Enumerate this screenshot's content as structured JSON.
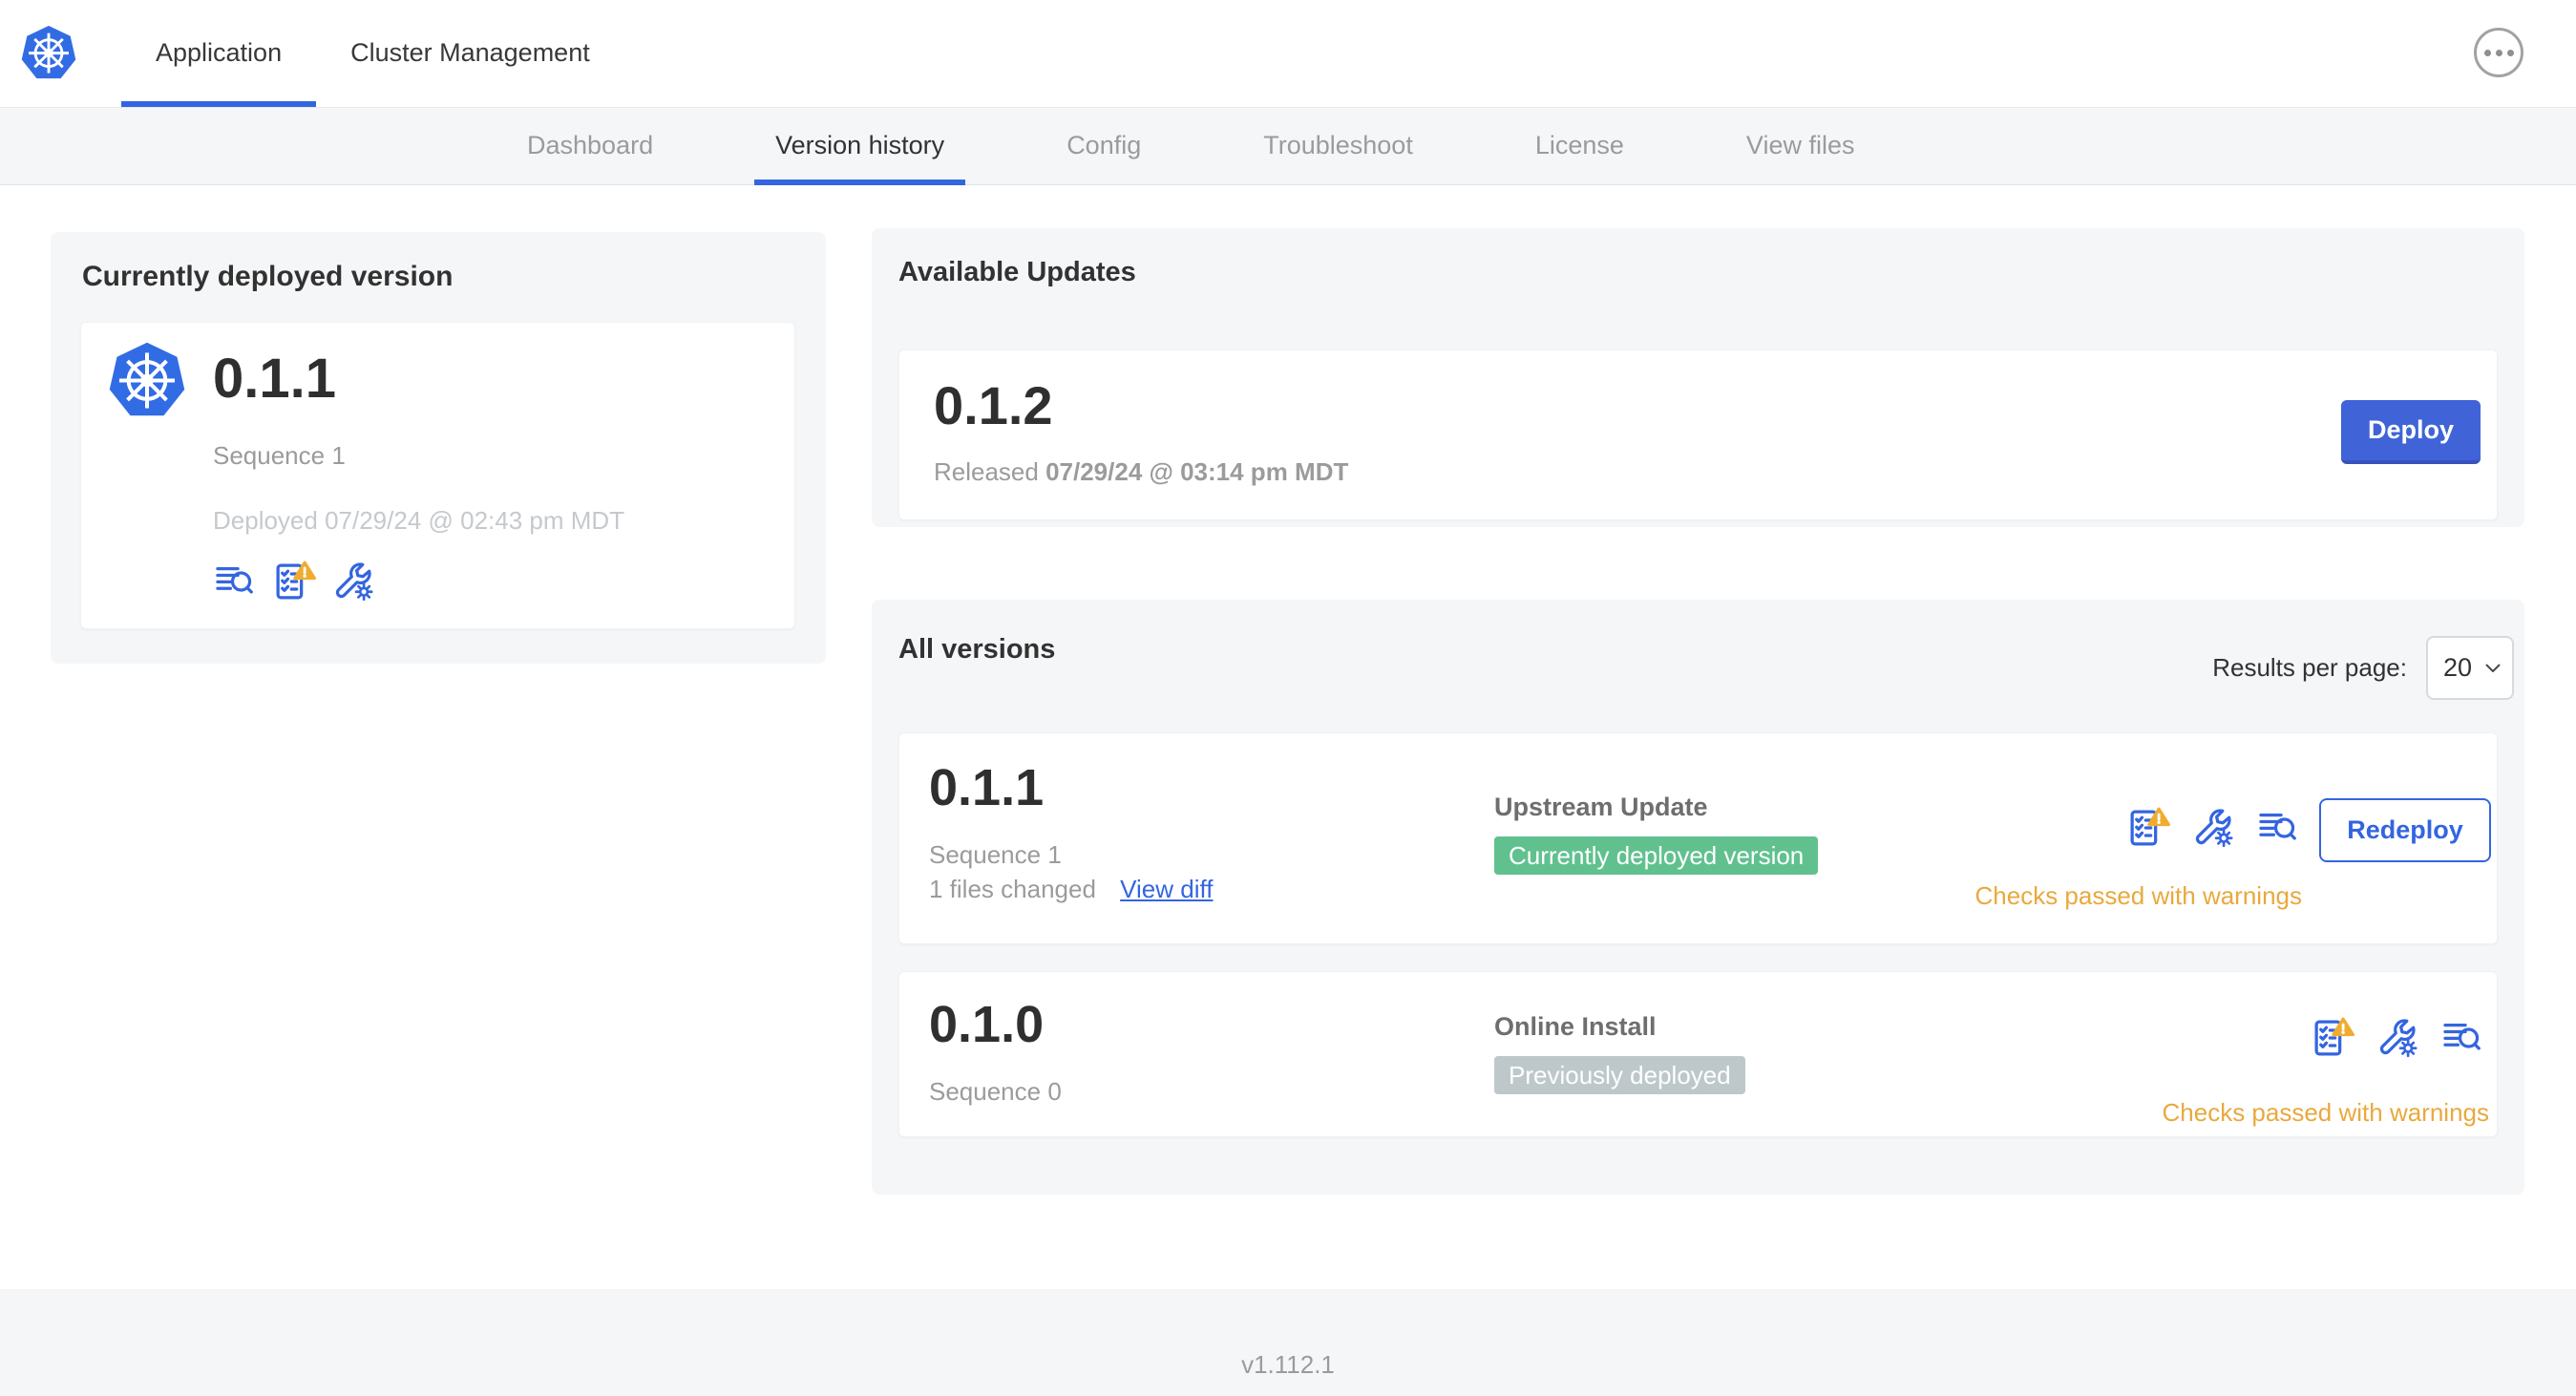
{
  "colors": {
    "accent_blue": "#3465E0",
    "kubernetes_blue": "#326CE5",
    "deploy_button_blue": "#4064D7",
    "success_green": "#60C18F",
    "previously_deployed_gray": "#BEC8CA",
    "warning_amber": "#E9A93D",
    "card_background": "#F5F6F8"
  },
  "header": {
    "tabs": [
      {
        "label": "Application"
      },
      {
        "label": "Cluster Management"
      }
    ]
  },
  "subnav": {
    "active_tab": "Version history",
    "tabs": [
      {
        "label": "Dashboard"
      },
      {
        "label": "Version history"
      },
      {
        "label": "Config"
      },
      {
        "label": "Troubleshoot"
      },
      {
        "label": "License"
      },
      {
        "label": "View files"
      }
    ]
  },
  "current_version": {
    "title": "Currently deployed version",
    "version": "0.1.1",
    "sequence": "Sequence 1",
    "deployed": "Deployed 07/29/24 @ 02:43 pm MDT"
  },
  "available_updates": {
    "title": "Available Updates",
    "version": "0.1.2",
    "released_prefix": "Released ",
    "released_date": "07/29/24 @ 03:14 pm MDT",
    "deploy_label": "Deploy"
  },
  "all_versions": {
    "title": "All versions",
    "results_per_page_label": "Results per page:",
    "results_per_page_value": "20",
    "rows": [
      {
        "version": "0.1.1",
        "sequence": "Sequence 1",
        "files_changed": "1 files changed",
        "view_diff_label": "View diff",
        "source": "Upstream Update",
        "badge_label": "Currently deployed version",
        "status_text": "Checks passed with warnings",
        "action_label": "Redeploy"
      },
      {
        "version": "0.1.0",
        "sequence": "Sequence 0",
        "source": "Online Install",
        "badge_label": "Previously deployed",
        "status_text": "Checks passed with warnings"
      }
    ]
  },
  "footer": {
    "app_version": "v1.112.1"
  }
}
